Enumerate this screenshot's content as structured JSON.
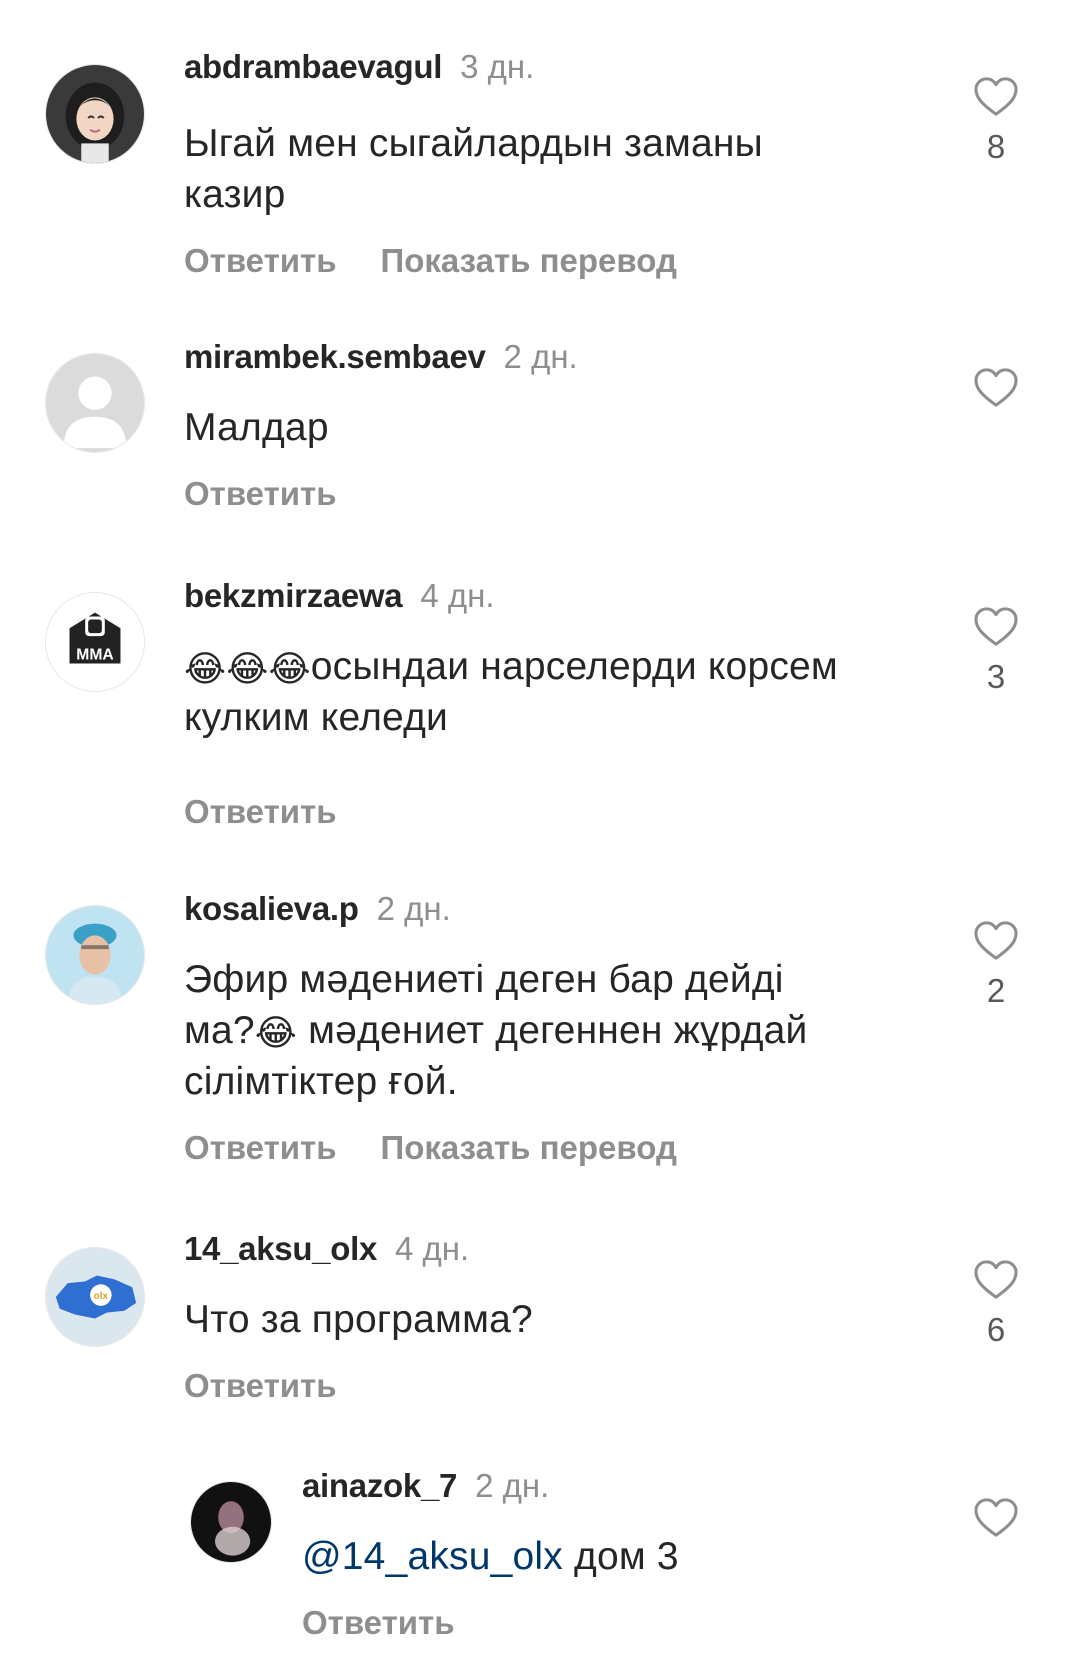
{
  "comments": [
    {
      "username": "abdrambaevagul",
      "time": "3 дн.",
      "text_lines": [
        "Ыгай мен сыгайлардын заманы",
        "казир"
      ],
      "reply_label": "Ответить",
      "translate_label": "Показать перевод",
      "likes": "8",
      "avatar": "avatar-cartoon-girl"
    },
    {
      "username": "mirambek.sembaev",
      "time": "2 дн.",
      "text_lines": [
        "Малдар"
      ],
      "reply_label": "Ответить",
      "avatar": "avatar-default-user"
    },
    {
      "username": "bekzmirzaewa",
      "time": "4 дн.",
      "emoji": "😂😂😂",
      "text_lines": [
        "осындаи нарселерди корсем",
        "кулким келеди"
      ],
      "reply_label": "Ответить",
      "likes": "3",
      "avatar": "avatar-mma-logo",
      "avatar_text": "MMA"
    },
    {
      "username": "kosalieva.p",
      "time": "2 дн.",
      "text_lines": [
        "Эфир мәдениеті деген бар дейді",
        "ма?",
        " мәдениет дегеннен жұрдай",
        "сілімтіктер ғой."
      ],
      "emoji": "😂",
      "reply_label": "Ответить",
      "translate_label": "Показать перевод",
      "likes": "2",
      "avatar": "avatar-photo-woman"
    },
    {
      "username": "14_aksu_olx",
      "time": "4 дн.",
      "text_lines": [
        "Что за программа?"
      ],
      "reply_label": "Ответить",
      "likes": "6",
      "avatar": "avatar-olx-map",
      "avatar_text": "olx"
    },
    {
      "username": "ainazok_7",
      "time": "2 дн.",
      "mention": "@14_aksu_olx",
      "text_lines": [
        " дом 3"
      ],
      "reply_label": "Ответить",
      "avatar": "avatar-dark-photo"
    }
  ],
  "icons": {
    "like": "heart-outline-icon"
  },
  "colors": {
    "text": "#262626",
    "secondary": "#8e8e8e",
    "mention": "#00376b"
  }
}
